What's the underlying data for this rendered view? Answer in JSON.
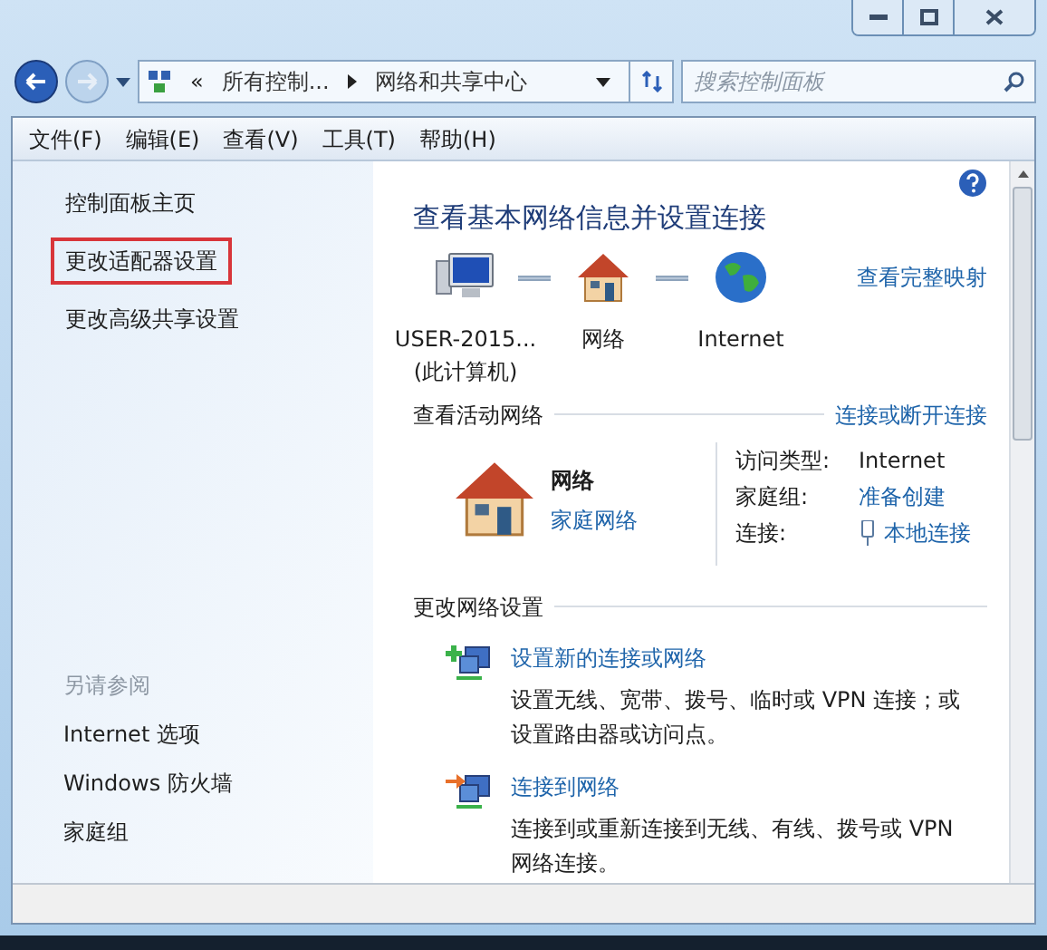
{
  "address_bar": {
    "overflow_mark": "«",
    "breadcrumbs": [
      "所有控制...",
      "网络和共享中心"
    ]
  },
  "search": {
    "placeholder": "搜索控制面板"
  },
  "menu": [
    "文件(F)",
    "编辑(E)",
    "查看(V)",
    "工具(T)",
    "帮助(H)"
  ],
  "sidebar": {
    "items": [
      {
        "label": "控制面板主页",
        "highlighted": false
      },
      {
        "label": "更改适配器设置",
        "highlighted": true
      },
      {
        "label": "更改高级共享设置",
        "highlighted": false
      }
    ],
    "see_also": {
      "title": "另请参阅",
      "items": [
        "Internet 选项",
        "Windows 防火墙",
        "家庭组"
      ]
    }
  },
  "main": {
    "title": "查看基本网络信息并设置连接",
    "map_link": "查看完整映射",
    "nodes": [
      {
        "kind": "computer",
        "label": "USER-2015...",
        "sublabel": "(此计算机)"
      },
      {
        "kind": "house",
        "label": "网络"
      },
      {
        "kind": "globe",
        "label": "Internet"
      }
    ],
    "active_networks": {
      "heading": "查看活动网络",
      "link": "连接或断开连接",
      "name": "网络",
      "type": "家庭网络",
      "details": [
        {
          "label": "访问类型:",
          "value": "Internet",
          "kind": "text"
        },
        {
          "label": "家庭组:",
          "value": "准备创建",
          "kind": "link"
        },
        {
          "label": "连接:",
          "value": "本地连接",
          "kind": "adapter"
        }
      ]
    },
    "change_settings": {
      "heading": "更改网络设置",
      "tasks": [
        {
          "kind": "new",
          "title": "设置新的连接或网络",
          "description": "设置无线、宽带、拨号、临时或 VPN 连接；或设置路由器或访问点。"
        },
        {
          "kind": "connect",
          "title": "连接到网络",
          "description": "连接到或重新连接到无线、有线、拨号或 VPN 网络连接。"
        }
      ]
    }
  }
}
